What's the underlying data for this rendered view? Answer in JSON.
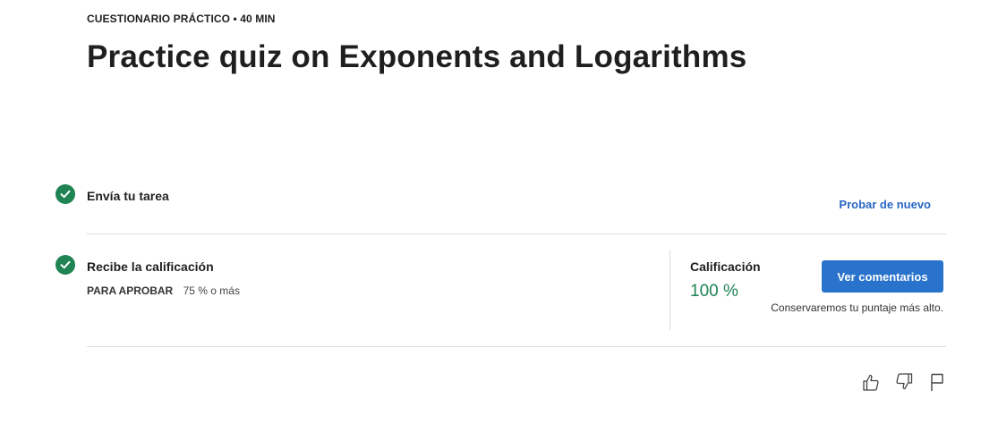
{
  "header": {
    "eyebrow": "CUESTIONARIO PRÁCTICO • 40 MIN",
    "title": "Practice quiz on Exponents and Logarithms"
  },
  "submit_step": {
    "title": "Envía tu tarea",
    "retry_link": "Probar de nuevo",
    "status_icon": "check-circle-icon"
  },
  "grade_step": {
    "title": "Recibe la calificación",
    "pass_label": "PARA APROBAR",
    "pass_value": "75 % o más",
    "grade_label": "Calificación",
    "grade_value": "100 %",
    "view_feedback_button": "Ver comentarios",
    "note": "Conservaremos tu puntaje más alto.",
    "status_icon": "check-circle-icon"
  },
  "feedback_tools": [
    "thumbs-up-icon",
    "thumbs-down-icon",
    "flag-icon"
  ],
  "colors": {
    "success": "#1f8354",
    "primary": "#2a73cc",
    "link": "#2a66c4",
    "divider": "#dcdcdc"
  }
}
